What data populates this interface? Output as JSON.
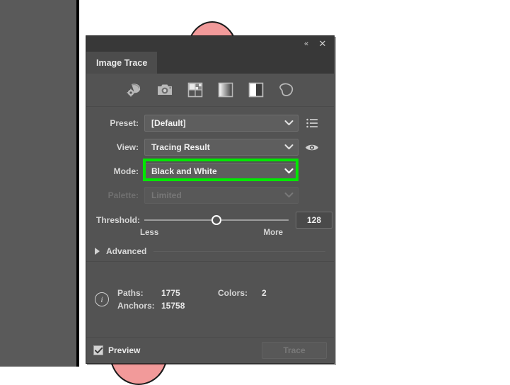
{
  "window": {
    "panel_title": "Image Trace",
    "collapse_icon": "«",
    "close_icon": "✕"
  },
  "mode_icons": [
    {
      "name": "auto-color-icon",
      "title": "Auto-Color"
    },
    {
      "name": "high-color-photo-icon",
      "title": "High Color"
    },
    {
      "name": "low-color-icon",
      "title": "Low Color"
    },
    {
      "name": "grayscale-icon",
      "title": "Grayscale"
    },
    {
      "name": "black-and-white-icon",
      "title": "Black and White"
    },
    {
      "name": "outline-icon",
      "title": "Outline"
    }
  ],
  "form": {
    "preset": {
      "label": "Preset:",
      "value": "[Default]",
      "menu_icon": "preset-menu-icon"
    },
    "view": {
      "label": "View:",
      "value": "Tracing Result",
      "eye_icon": "eye-icon"
    },
    "mode": {
      "label": "Mode:",
      "value": "Black and White",
      "highlight_color": "#00e800"
    },
    "palette": {
      "label": "Palette:",
      "value": "Limited",
      "disabled": true
    }
  },
  "threshold": {
    "label": "Threshold:",
    "value": "128",
    "min_label": "Less",
    "max_label": "More",
    "position_percent": 50
  },
  "advanced": {
    "label": "Advanced",
    "expanded": false
  },
  "info": {
    "paths_key": "Paths:",
    "paths_value": "1775",
    "anchors_key": "Anchors:",
    "anchors_value": "15758",
    "colors_key": "Colors:",
    "colors_value": "2"
  },
  "footer": {
    "preview_label": "Preview",
    "preview_checked": true,
    "trace_label": "Trace",
    "trace_enabled": false
  }
}
